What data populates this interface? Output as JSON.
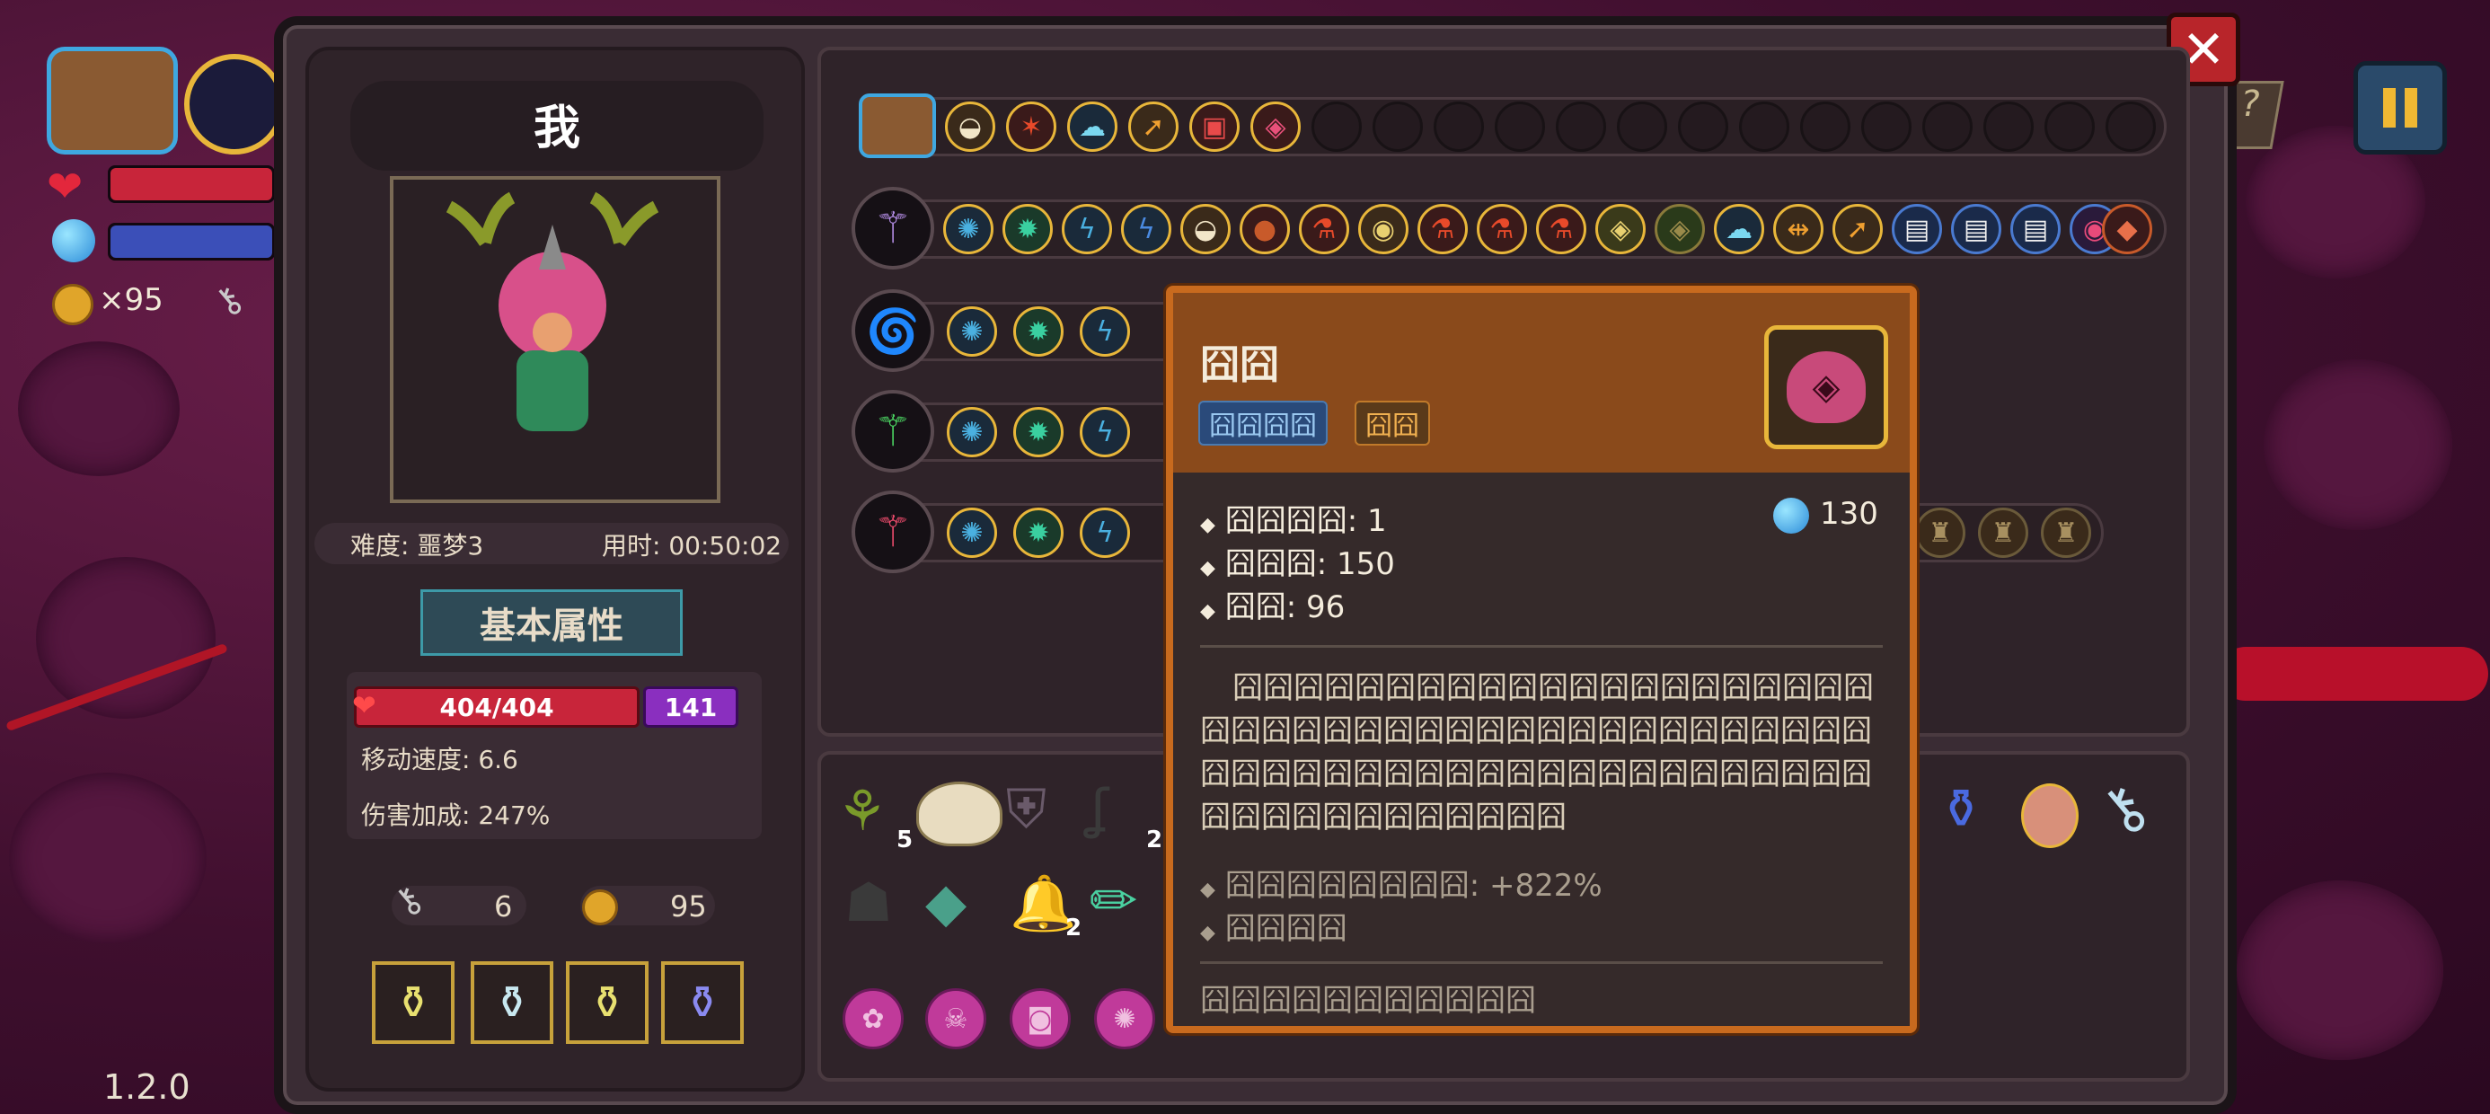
{
  "hud": {
    "coins": "×95",
    "version": "1.2.0"
  },
  "character": {
    "name": "我",
    "difficulty": "难度: 噩梦3",
    "time": "用时: 00:50:02",
    "section_title": "基本属性",
    "hp": "404/404",
    "shield": "141",
    "move_speed": "移动速度: 6.6",
    "damage_bonus": "伤害加成: 247%",
    "keys": "6",
    "gold": "95"
  },
  "inventory": {
    "counts": {
      "item1": "5",
      "item4": "2",
      "item7": "2"
    }
  },
  "tooltip": {
    "title": "囧囧",
    "tag1": "囧囧囧囧",
    "tag2": "囧囧",
    "stat1": "囧囧囧囧: 1",
    "stat2": "囧囧囧: 150",
    "stat3": "囧囧: 96",
    "cost": "130",
    "desc": "囧囧囧囧囧囧囧囧囧囧囧囧囧囧囧囧囧囧囧囧囧囧囧囧囧囧囧囧囧囧囧囧囧囧囧囧囧囧囧囧囧囧囧囧囧囧囧囧囧囧囧囧囧囧囧囧囧囧囧囧囧囧囧囧囧囧囧囧囧囧囧囧囧囧囧囧囧",
    "bonus1": "囧囧囧囧囧囧囧囧: +822%",
    "bonus2": "囧囧囧囧",
    "footer": "囧囧囧囧囧囧囧囧囧囧囧"
  },
  "colors": {
    "hp": "#d42a3a",
    "mana": "#3b4fb8",
    "shield": "#8a2fbf",
    "accent": "#c86a1e"
  }
}
